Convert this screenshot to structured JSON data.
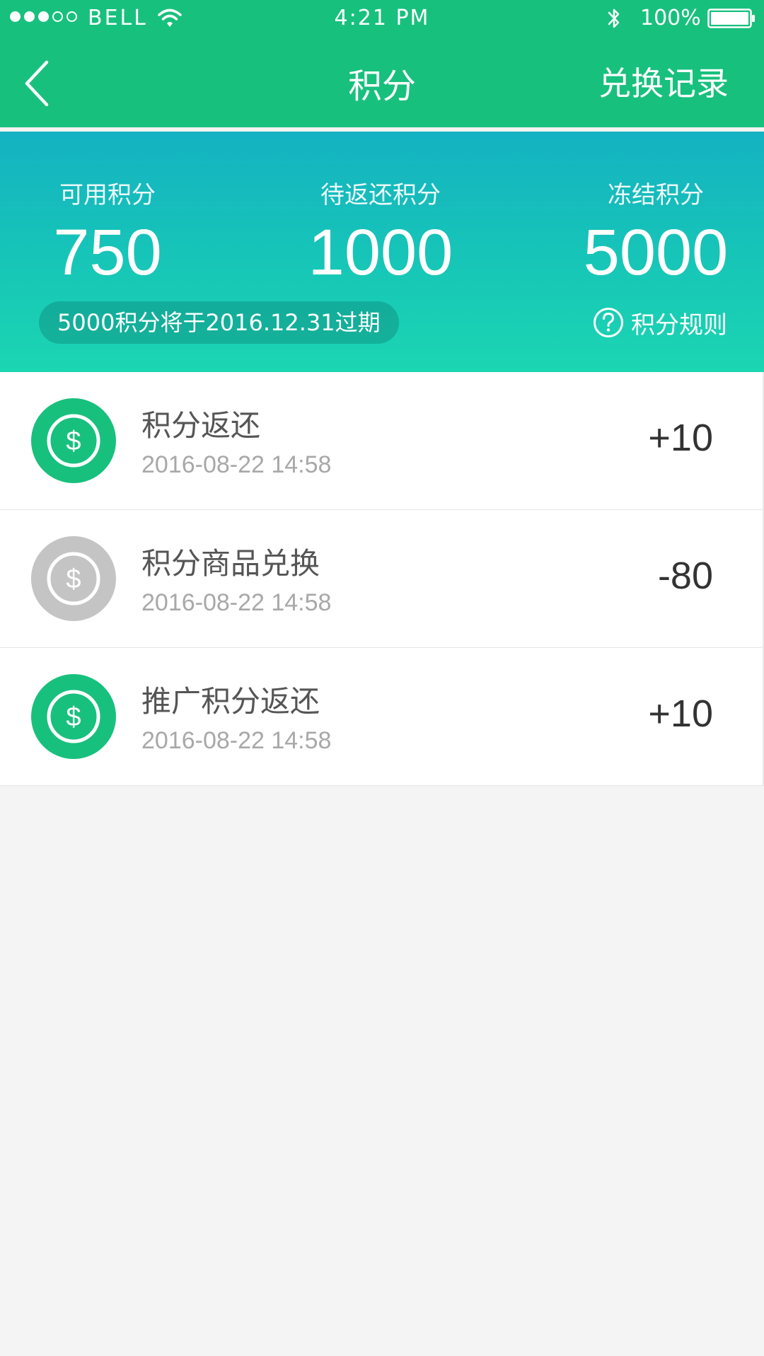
{
  "status_bar": {
    "carrier": "BELL",
    "time": "4:21 PM",
    "battery": "100%",
    "signal_bars_filled": 3,
    "signal_bars_total": 5,
    "battery_level": 1.0
  },
  "nav": {
    "back_icon": "chevron-left-icon",
    "title": "积分",
    "history_label": "兑换记录"
  },
  "summary": {
    "available_label": "可用积分",
    "available_value": "750",
    "pending_label": "待返还积分",
    "pending_value": "1000",
    "frozen_label": "冻结积分",
    "frozen_value": "5000",
    "expire_notice": "5000积分将于2016.12.31过期",
    "rules_icon": "help-circle-icon",
    "rules_label": "积分规则"
  },
  "records": [
    {
      "title": "积分返还",
      "time": "2016-08-22 14:58",
      "points": "+10",
      "icon": "dollar-coin-icon",
      "icon_color": "#18c07d"
    },
    {
      "title": "积分商品兑换",
      "time": "2016-08-22 14:58",
      "points": "-80",
      "icon": "dollar-coin-icon",
      "icon_color": "#c4c4c4"
    },
    {
      "title": "推广积分返还",
      "time": "2016-08-22 14:58",
      "points": "+10",
      "icon": "dollar-coin-icon",
      "icon_color": "#18c07d"
    }
  ],
  "colors": {
    "primary": "#18c07d",
    "summary_gradient_top": "#14b2c2",
    "summary_gradient_bottom": "#1bd6b2",
    "background": "#f4f4f4"
  }
}
